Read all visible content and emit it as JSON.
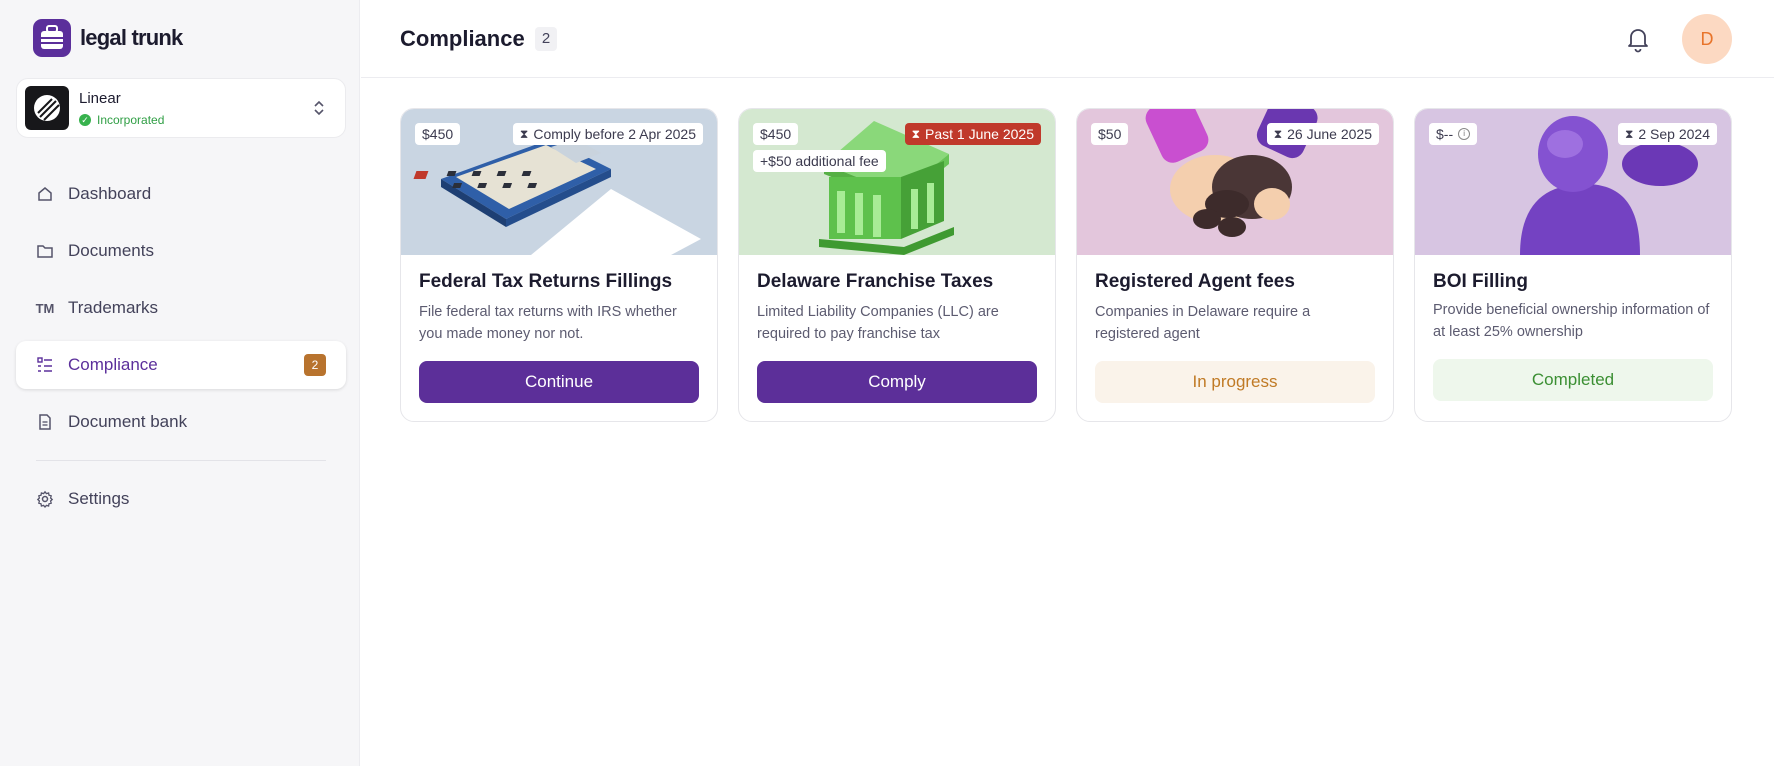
{
  "brand": {
    "name": "legal trunk",
    "color": "#5b2f9b"
  },
  "company": {
    "name": "Linear",
    "status": "Incorporated"
  },
  "nav": {
    "items": [
      {
        "label": "Dashboard",
        "icon": "home-icon"
      },
      {
        "label": "Documents",
        "icon": "folder-icon"
      },
      {
        "label": "Trademarks",
        "icon": "trademark-icon"
      },
      {
        "label": "Compliance",
        "icon": "list-check-icon",
        "active": true,
        "badge": "2"
      },
      {
        "label": "Document bank",
        "icon": "document-icon"
      }
    ],
    "settings": {
      "label": "Settings",
      "icon": "gear-icon"
    }
  },
  "header": {
    "title": "Compliance",
    "count": "2",
    "user_initial": "D"
  },
  "cards": [
    {
      "title": "Federal Tax Returns Fillings",
      "price": "$450",
      "due": "Comply before 2 Apr 2025",
      "description": "File federal tax returns with IRS whether you made money nor not.",
      "action": "Continue"
    },
    {
      "title": "Delaware Franchise Taxes",
      "price": "$450",
      "due": "Past 1 June 2025",
      "fee": "+$50 additional fee",
      "description": "Limited Liability Companies (LLC) are required to pay franchise tax",
      "action": "Comply"
    },
    {
      "title": "Registered Agent fees",
      "price": "$50",
      "due": "26 June 2025",
      "description": "Companies in Delaware require a registered agent",
      "action": "In progress"
    },
    {
      "title": "BOI Filling",
      "price": "$--",
      "due": "2 Sep 2024",
      "description": "Provide beneficial ownership information of  at least 25% ownership",
      "action": "Completed"
    }
  ],
  "colors": {
    "overdue": "#c0392b",
    "badge": "#b8732e",
    "in_progress": "#c07a25",
    "completed": "#3b8f33"
  }
}
